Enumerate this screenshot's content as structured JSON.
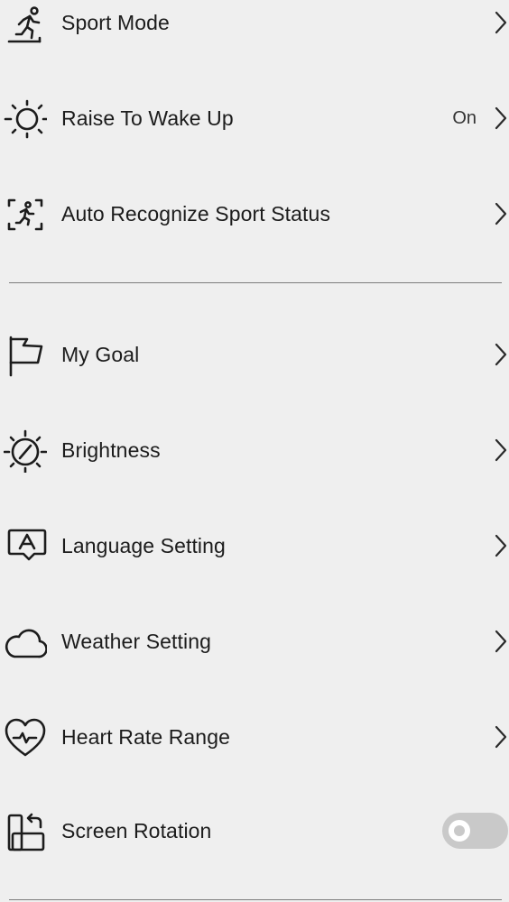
{
  "settings": {
    "group1": [
      {
        "label": "Sport Mode",
        "icon": "sport-mode-icon"
      },
      {
        "label": "Raise To Wake Up",
        "value": "On",
        "icon": "sun-icon"
      },
      {
        "label": "Auto Recognize Sport Status",
        "icon": "auto-recognize-icon"
      }
    ],
    "group2": [
      {
        "label": "My Goal",
        "icon": "flag-icon"
      },
      {
        "label": "Brightness",
        "icon": "brightness-icon"
      },
      {
        "label": "Language Setting",
        "icon": "language-icon"
      },
      {
        "label": "Weather Setting",
        "icon": "cloud-icon"
      },
      {
        "label": "Heart Rate Range",
        "icon": "heart-rate-icon"
      },
      {
        "label": "Screen Rotation",
        "icon": "screen-rotation-icon",
        "toggle_on": false
      }
    ]
  },
  "colors": {
    "background": "#efefef",
    "text": "#1c1c1c",
    "divider": "#7d7d7d",
    "toggle_track_off": "#c9c9c9"
  }
}
